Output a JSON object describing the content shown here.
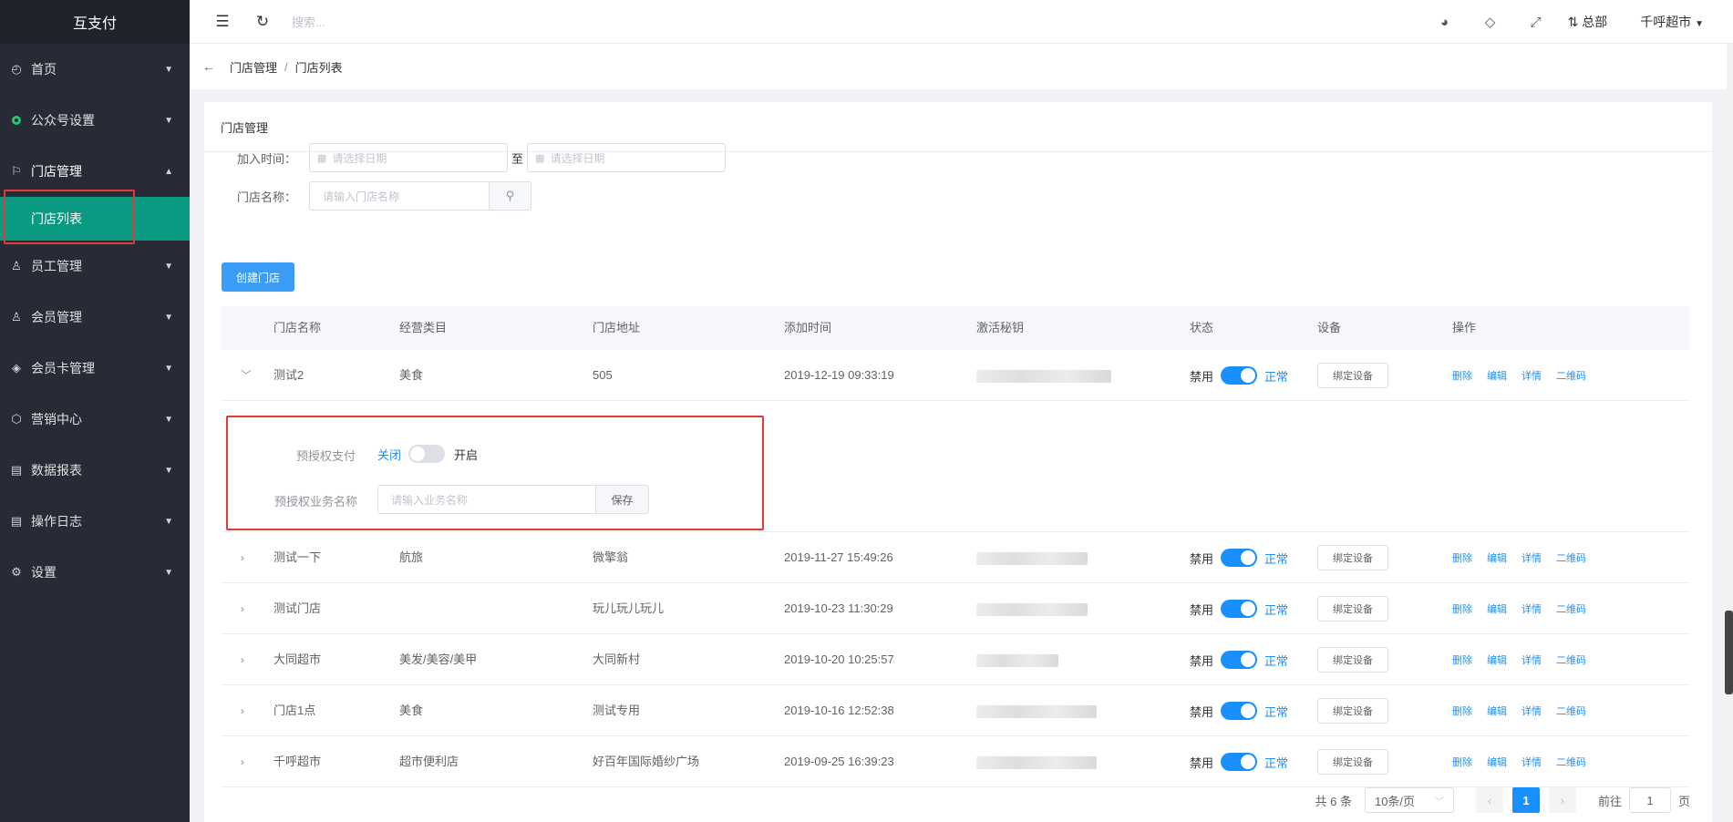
{
  "sidebar": {
    "brand": "互支付",
    "items": [
      {
        "label": "首页",
        "icon": "dashboard-icon"
      },
      {
        "label": "公众号设置",
        "icon": "green-circle-icon"
      },
      {
        "label": "门店管理",
        "icon": "flag-icon"
      },
      {
        "label": "员工管理",
        "icon": "user-icon"
      },
      {
        "label": "会员管理",
        "icon": "user-icon"
      },
      {
        "label": "会员卡管理",
        "icon": "diamond-icon"
      },
      {
        "label": "营销中心",
        "icon": "cube-icon"
      },
      {
        "label": "数据报表",
        "icon": "report-icon"
      },
      {
        "label": "操作日志",
        "icon": "log-icon"
      },
      {
        "label": "设置",
        "icon": "gear-icon"
      }
    ],
    "active_sub": "门店列表"
  },
  "header": {
    "search_placeholder": "搜索...",
    "branch": "总部",
    "user": "千呼超市"
  },
  "breadcrumb": {
    "parent": "门店管理",
    "current": "门店列表"
  },
  "card": {
    "title": "门店管理",
    "join_time_label": "加入时间：",
    "date_placeholder": "请选择日期",
    "to": "至",
    "store_name_label": "门店名称：",
    "store_name_placeholder": "请输入门店名称",
    "create_button": "创建门店"
  },
  "table": {
    "headers": [
      "门店名称",
      "经营类目",
      "门店地址",
      "添加时间",
      "激活秘钥",
      "状态",
      "设备",
      "操作"
    ],
    "rows": [
      {
        "name": "测试2",
        "category": "美食",
        "address": "505",
        "time": "2019-12-19 09:33:19"
      },
      {
        "name": "测试一下",
        "category": "航旅",
        "address": "微擎翁",
        "time": "2019-11-27 15:49:26"
      },
      {
        "name": "测试门店",
        "category": "",
        "address": "玩儿玩儿玩儿",
        "time": "2019-10-23 11:30:29"
      },
      {
        "name": "大同超市",
        "category": "美发/美容/美甲",
        "address": "大同新村",
        "time": "2019-10-20 10:25:57"
      },
      {
        "name": "门店1点",
        "category": "美食",
        "address": "测试专用",
        "time": "2019-10-16 12:52:38"
      },
      {
        "name": "千呼超市",
        "category": "超市便利店",
        "address": "好百年国际婚纱广场",
        "time": "2019-09-25 16:39:23"
      }
    ],
    "status_off": "禁用",
    "status_on": "正常",
    "bind_device": "绑定设备",
    "ops": [
      "删除",
      "编辑",
      "详情",
      "二维码"
    ]
  },
  "expanded": {
    "preauth_label": "预授权支付",
    "off": "关闭",
    "on": "开启",
    "biz_label": "预授权业务名称",
    "biz_placeholder": "请输入业务名称",
    "save": "保存"
  },
  "pagination": {
    "total": "共 6 条",
    "page_size": "10条/页",
    "current": "1",
    "goto": "前往",
    "goto_value": "1",
    "page_unit": "页"
  },
  "colors": {
    "sidebar_bg": "#262b35",
    "active_submenu": "#0a9a82",
    "primary": "#1890ff",
    "highlight": "#e53935"
  }
}
